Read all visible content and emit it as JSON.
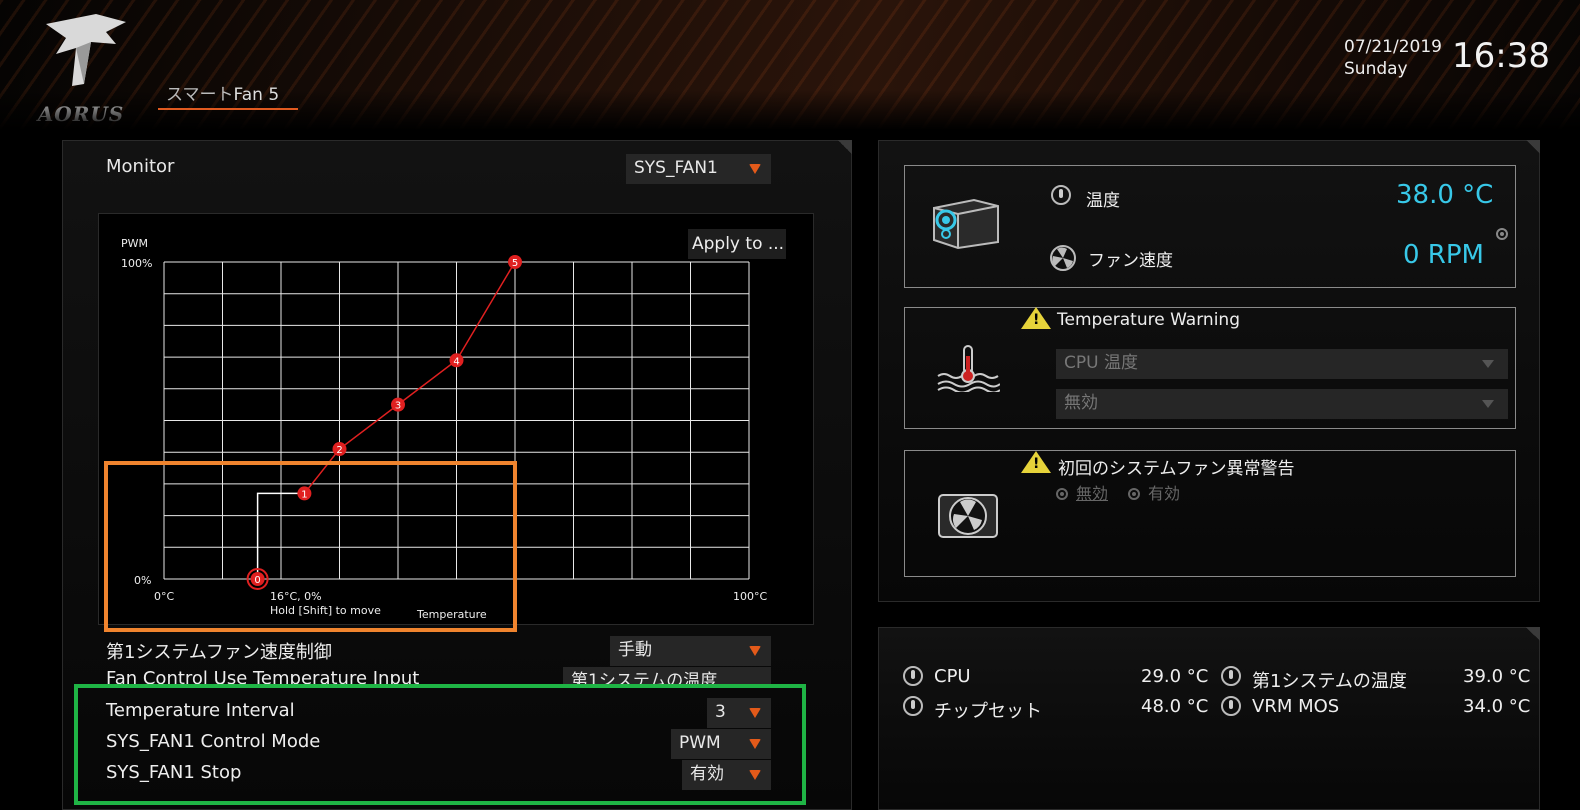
{
  "header": {
    "logo_text": "AORUS",
    "tab_prefix": "スマート",
    "tab_suffix": "Fan 5",
    "date": "07/21/2019",
    "day": "Sunday",
    "time": "16:38"
  },
  "monitor": {
    "label": "Monitor",
    "selected": "SYS_FAN1"
  },
  "chart_data": {
    "type": "line",
    "ylabel": "PWM",
    "xlabel": "Temperature",
    "y_ticks": [
      "100%",
      "0%"
    ],
    "x_ticks": [
      "0°C",
      "100°C"
    ],
    "xlim": [
      0,
      100
    ],
    "ylim": [
      0,
      100
    ],
    "grid": true,
    "apply_button": "Apply to ...",
    "points": [
      {
        "label": "0",
        "x": 16,
        "y": 0
      },
      {
        "label": "1",
        "x": 24,
        "y": 27
      },
      {
        "label": "2",
        "x": 30,
        "y": 41
      },
      {
        "label": "3",
        "x": 40,
        "y": 55
      },
      {
        "label": "4",
        "x": 50,
        "y": 69
      },
      {
        "label": "5",
        "x": 60,
        "y": 100
      }
    ],
    "step_corner": {
      "x": 16,
      "y": 27
    },
    "active_point_text": "16°C, 0%",
    "hint": "Hold [Shift] to move"
  },
  "settings": [
    {
      "label": "第1システムファン速度制御",
      "value": "手動"
    },
    {
      "label": "Fan Control Use Temperature Input",
      "value": "第1システムの温度"
    },
    {
      "label": "Temperature Interval",
      "value": "3"
    },
    {
      "label": "SYS_FAN1 Control Mode",
      "value": "PWM"
    },
    {
      "label": "SYS_FAN1 Stop",
      "value": "有効"
    }
  ],
  "status_card": {
    "temp_label": "温度",
    "temp_value": "38.0 °C",
    "fan_label": "ファン速度",
    "fan_value": "0 RPM"
  },
  "temp_warning": {
    "title": "Temperature Warning",
    "source": "CPU 温度",
    "level": "無効"
  },
  "fan_fail_warning": {
    "title": "初回のシステムファン異常警告",
    "option_off": "無効",
    "option_on": "有効"
  },
  "temperatures": {
    "cpu_label": "CPU",
    "cpu_value": "29.0 °C",
    "chipset_label": "チップセット",
    "chipset_value": "48.0 °C",
    "sys1_label": "第1システムの温度",
    "sys1_value": "39.0 °C",
    "vrm_label": "VRM MOS",
    "vrm_value": "34.0 °C"
  },
  "colors": {
    "accent": "#e35a1a",
    "value_cyan": "#38c8e8",
    "curve_red": "#e02020",
    "highlight_orange": "#f0842e",
    "highlight_green": "#1fb445"
  }
}
